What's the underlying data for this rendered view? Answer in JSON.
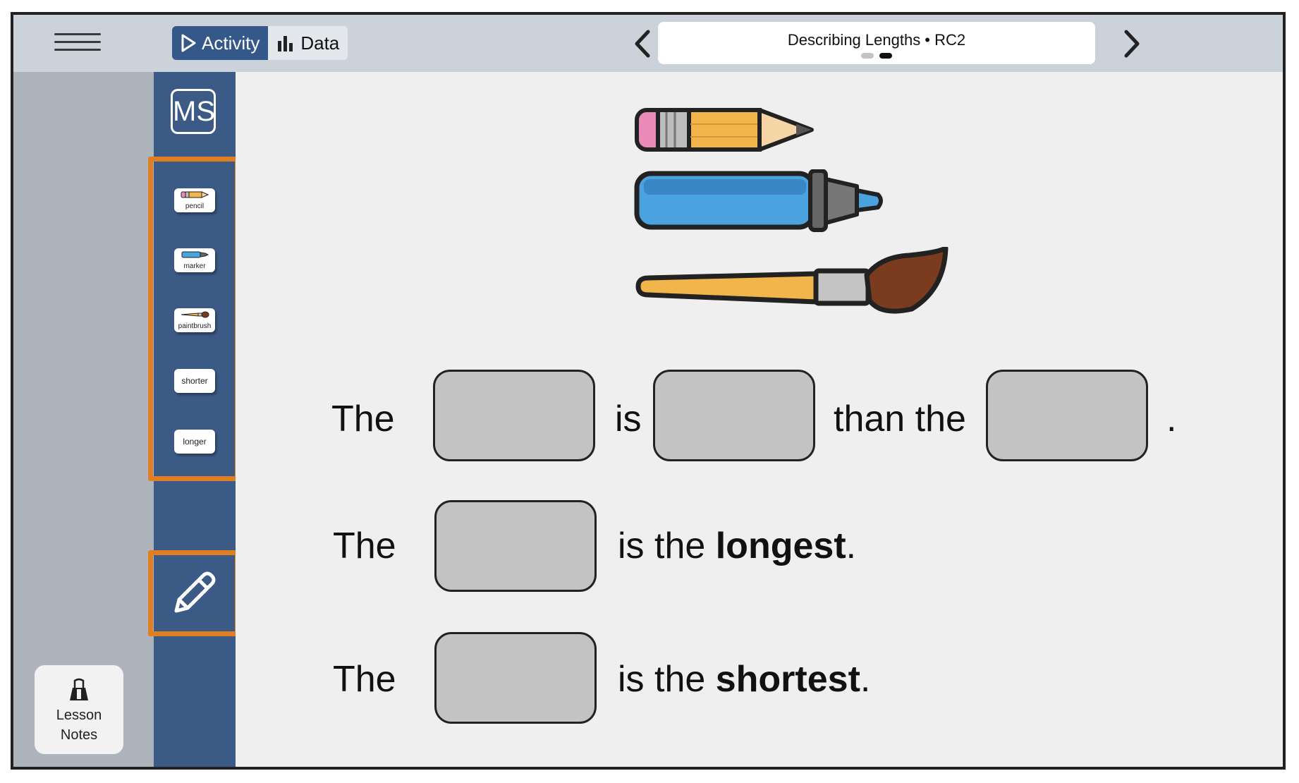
{
  "topbar": {
    "tabs": [
      {
        "label": "Activity",
        "icon": "play-icon",
        "active": true
      },
      {
        "label": "Data",
        "icon": "bar-chart-icon",
        "active": false
      }
    ],
    "title": "Describing Lengths • RC2",
    "page_dots": 2,
    "current_dot": 2
  },
  "sidebar": {
    "user_initials": "MS",
    "word_cards": [
      {
        "label": "pencil",
        "icon": "pencil-icon"
      },
      {
        "label": "marker",
        "icon": "marker-icon"
      },
      {
        "label": "paintbrush",
        "icon": "paintbrush-icon"
      },
      {
        "label": "shorter"
      },
      {
        "label": "longer"
      }
    ],
    "tool": "pencil-tool-icon"
  },
  "lesson_notes": {
    "line1": "Lesson",
    "line2": "Notes"
  },
  "sentences": {
    "s1_the": "The",
    "s1_is": "is",
    "s1_than": "than the",
    "s1_period": ".",
    "s2_the": "The",
    "s2_rest": "is the ",
    "s2_bold": "longest",
    "s2_period": ".",
    "s3_the": "The",
    "s3_rest": "is the ",
    "s3_bold": "shortest",
    "s3_period": "."
  },
  "colors": {
    "accent": "#34588a",
    "highlight": "#e07e22",
    "blank": "#c3c3c3"
  }
}
